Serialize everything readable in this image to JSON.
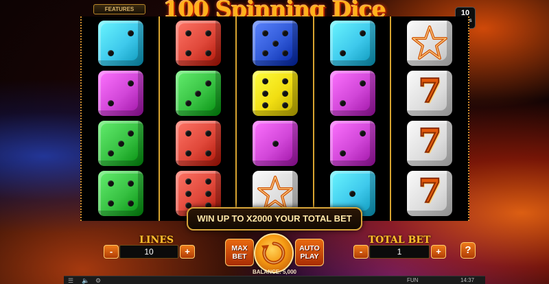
{
  "game": {
    "title": "100 Spinning Dice",
    "features_label": "FEATURES",
    "lines_badge": {
      "value": "10",
      "label": "Lines"
    }
  },
  "colors": {
    "cyan": "#3ec9ec",
    "red": "#e0483a",
    "blue": "#2f58d6",
    "magenta": "#d146d8",
    "green": "#37c142",
    "yellow": "#f1de12",
    "white": "#e6e6e6",
    "accent": "#f08a15"
  },
  "reels": [
    [
      {
        "type": "die",
        "color": "cyan",
        "pips": 2
      },
      {
        "type": "die",
        "color": "magenta",
        "pips": 2
      },
      {
        "type": "die",
        "color": "green",
        "pips": 3
      },
      {
        "type": "die",
        "color": "green",
        "pips": 4
      }
    ],
    [
      {
        "type": "die",
        "color": "red",
        "pips": 4
      },
      {
        "type": "die",
        "color": "green",
        "pips": 3
      },
      {
        "type": "die",
        "color": "red",
        "pips": 4
      },
      {
        "type": "die",
        "color": "red",
        "pips": 6
      }
    ],
    [
      {
        "type": "die",
        "color": "blue",
        "pips": 5
      },
      {
        "type": "die",
        "color": "yellow",
        "pips": 6
      },
      {
        "type": "die",
        "color": "magenta",
        "pips": 1
      },
      {
        "type": "symbol",
        "symbol": "star-icon"
      }
    ],
    [
      {
        "type": "die",
        "color": "cyan",
        "pips": 2
      },
      {
        "type": "die",
        "color": "magenta",
        "pips": 2
      },
      {
        "type": "die",
        "color": "magenta",
        "pips": 2
      },
      {
        "type": "die",
        "color": "cyan",
        "pips": 1
      }
    ],
    [
      {
        "type": "symbol",
        "symbol": "star-icon"
      },
      {
        "type": "symbol",
        "symbol": "seven-icon",
        "text": "7"
      },
      {
        "type": "symbol",
        "symbol": "seven-icon",
        "text": "7"
      },
      {
        "type": "symbol",
        "symbol": "seven-icon",
        "text": "7"
      }
    ]
  ],
  "banner": {
    "text": "WIN UP TO X2000 YOUR TOTAL BET"
  },
  "controls": {
    "lines": {
      "label": "LINES",
      "value": "10",
      "minus": "-",
      "plus": "+"
    },
    "max_bet": {
      "line1": "MAX",
      "line2": "BET"
    },
    "spin_icon": "spin-icon",
    "auto_play": {
      "line1": "AUTO",
      "line2": "PLAY"
    },
    "total_bet": {
      "label": "TOTAL BET",
      "value": "1",
      "minus": "-",
      "plus": "+"
    },
    "help": "?"
  },
  "balance": {
    "text": "BALANCE: 5,000"
  },
  "bottom_bar": {
    "mode": "FUN",
    "time": "14:37"
  }
}
